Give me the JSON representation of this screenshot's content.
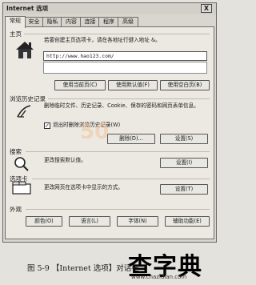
{
  "dialog": {
    "title": "Internet 选项",
    "close_label": "X"
  },
  "tabs": [
    "常规",
    "安全",
    "隐私",
    "内容",
    "连接",
    "程序",
    "高级"
  ],
  "home": {
    "heading": "主页",
    "description": "若要创建主页选项卡，请在各地址行键入地址 &。",
    "address": "http://www.hao123.com/",
    "buttons": [
      "使用当前页(C)",
      "使用默认值(F)",
      "使用空白页(B)"
    ]
  },
  "history": {
    "heading": "浏览历史记录",
    "description": "删除临时文件、历史记录、Cookie、保存的密码和网页表单信息。",
    "checkbox_label": "退出时删除浏览历史记录(W)",
    "checkbox_checked": true,
    "buttons": [
      "删除(D)...",
      "设置(S)"
    ]
  },
  "search": {
    "heading": "搜索",
    "description": "更改搜索默认值。",
    "button": "设置(I)"
  },
  "tabs_section": {
    "heading": "选项卡",
    "description": "更改网页在选项卡中显示的方式。",
    "button": "设置(T)"
  },
  "appearance": {
    "heading": "外观",
    "buttons": [
      "颜色(O)",
      "语言(L)",
      "字体(N)",
      "辅助功能(E)"
    ]
  },
  "watermark": {
    "logo_text": "查字典",
    "site": "www.chazidian.com",
    "faint_text": "50"
  },
  "caption": "图 5-9 【Internet 选项】对话框",
  "icons": {
    "home": "house-icon",
    "history": "history-icon",
    "search": "magnifier-icon",
    "tabs": "tabs-icon"
  }
}
